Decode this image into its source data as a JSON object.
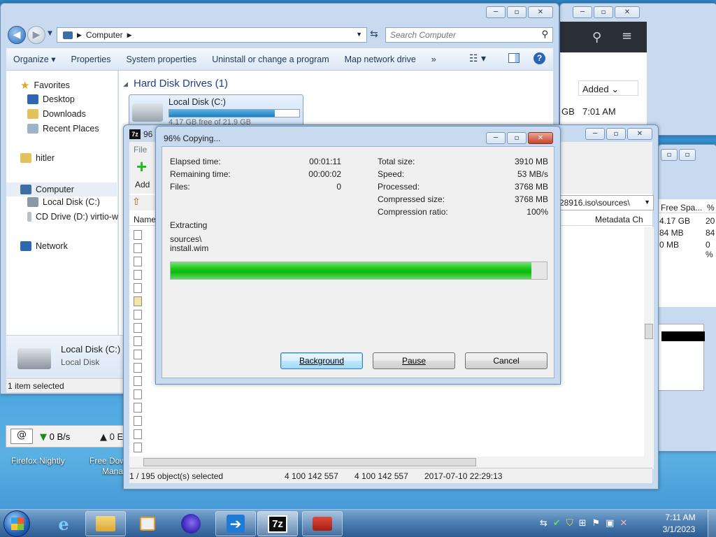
{
  "explorer": {
    "address_root": "Computer",
    "search_placeholder": "Search Computer",
    "commands": [
      "Organize ▾",
      "Properties",
      "System properties",
      "Uninstall or change a program",
      "Map network drive",
      "»"
    ],
    "nav": {
      "favorites": "Favorites",
      "desktop": "Desktop",
      "downloads": "Downloads",
      "recent": "Recent Places",
      "hitler": "hitler",
      "computer": "Computer",
      "local_disk": "Local Disk (C:)",
      "cd_drive": "CD Drive (D:) virtio-w",
      "network": "Network"
    },
    "group_header": "Hard Disk Drives (1)",
    "drive_name": "Local Disk (C:)",
    "drive_free": "4.17 GB free of 21.9 GB",
    "drive_usage": 0.81,
    "details_name": "Local Disk (C:)",
    "details_type": "Local Disk",
    "status": "1 item selected"
  },
  "bgwin": {
    "col_added": "Added",
    "size_frag": "GB",
    "time": "7:01 AM",
    "free_header": "Free Spa...",
    "pct_header": "%",
    "rows": [
      [
        "4.17 GB",
        "20"
      ],
      [
        "84 MB",
        "84"
      ],
      [
        "0 MB",
        "0 %"
      ]
    ]
  },
  "download_bar": {
    "speed1": "0 B/s",
    "speed2": "0 E"
  },
  "desktop": {
    "icon1": "Firefox Nightly",
    "icon2a": "Free Dow",
    "icon2b": "Mana"
  },
  "fm": {
    "title_frag": "96",
    "menu_file": "File",
    "add_label": "Add",
    "path": "28916.iso\\sources\\",
    "col_name": "Name",
    "col_meta": "Metadata Ch",
    "status_sel": "1 / 195 object(s) selected",
    "status_size": "4 100 142 557",
    "status_packed": "4 100 142 557",
    "status_date": "2017-07-10 22:29:13"
  },
  "dialog": {
    "title": "96% Copying...",
    "elapsed_label": "Elapsed time:",
    "elapsed": "00:01:11",
    "remaining_label": "Remaining time:",
    "remaining": "00:00:02",
    "files_label": "Files:",
    "files": "0",
    "total_label": "Total size:",
    "total": "3910 MB",
    "speed_label": "Speed:",
    "speed": "53 MB/s",
    "processed_label": "Processed:",
    "processed": "3768 MB",
    "compressed_label": "Compressed size:",
    "compressed": "3768 MB",
    "ratio_label": "Compression ratio:",
    "ratio": "100%",
    "action": "Extracting",
    "path_line1": "sources\\",
    "path_line2": "install.wim",
    "progress": 0.96,
    "btn_background": "Background",
    "btn_pause": "Pause",
    "btn_cancel": "Cancel"
  },
  "taskbar": {
    "time": "7:11 AM",
    "date": "3/1/2023"
  },
  "colors": {
    "progress": "#1ed41e",
    "accent": "#1e5aa8"
  }
}
